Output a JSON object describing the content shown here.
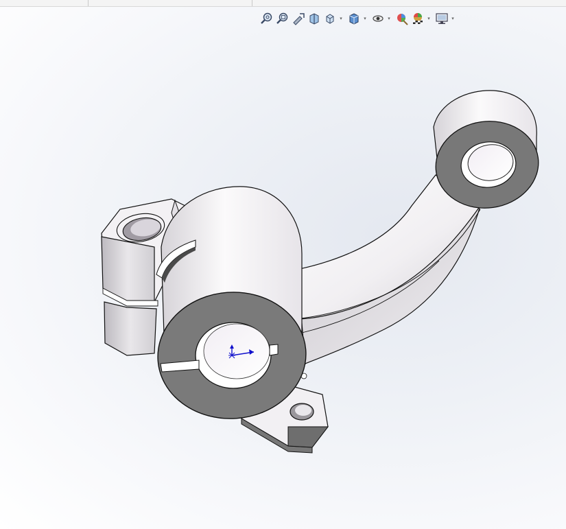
{
  "window": {
    "type": "3d-cad-viewport"
  },
  "toolbar": {
    "tools": [
      {
        "name": "zoom-to-fit-icon",
        "has_dropdown": false
      },
      {
        "name": "zoom-to-area-icon",
        "has_dropdown": false
      },
      {
        "name": "previous-view-icon",
        "has_dropdown": false
      },
      {
        "name": "section-view-icon",
        "has_dropdown": false
      },
      {
        "name": "view-orientation-icon",
        "has_dropdown": true
      },
      {
        "name": "display-style-icon",
        "has_dropdown": true
      },
      {
        "name": "hide-show-items-icon",
        "has_dropdown": true
      },
      {
        "name": "edit-appearance-icon",
        "has_dropdown": false
      },
      {
        "name": "apply-scene-icon",
        "has_dropdown": true
      },
      {
        "name": "view-settings-icon",
        "has_dropdown": true
      }
    ],
    "dropdown_glyph": "▾"
  },
  "model": {
    "description_icon": "bracket-part-icon",
    "colors": {
      "body_light": "#f6f4f6",
      "body_shadow": "#c9c6cc",
      "face_gray": "#777777",
      "edge": "#111111",
      "triad": "#1010cc"
    }
  }
}
